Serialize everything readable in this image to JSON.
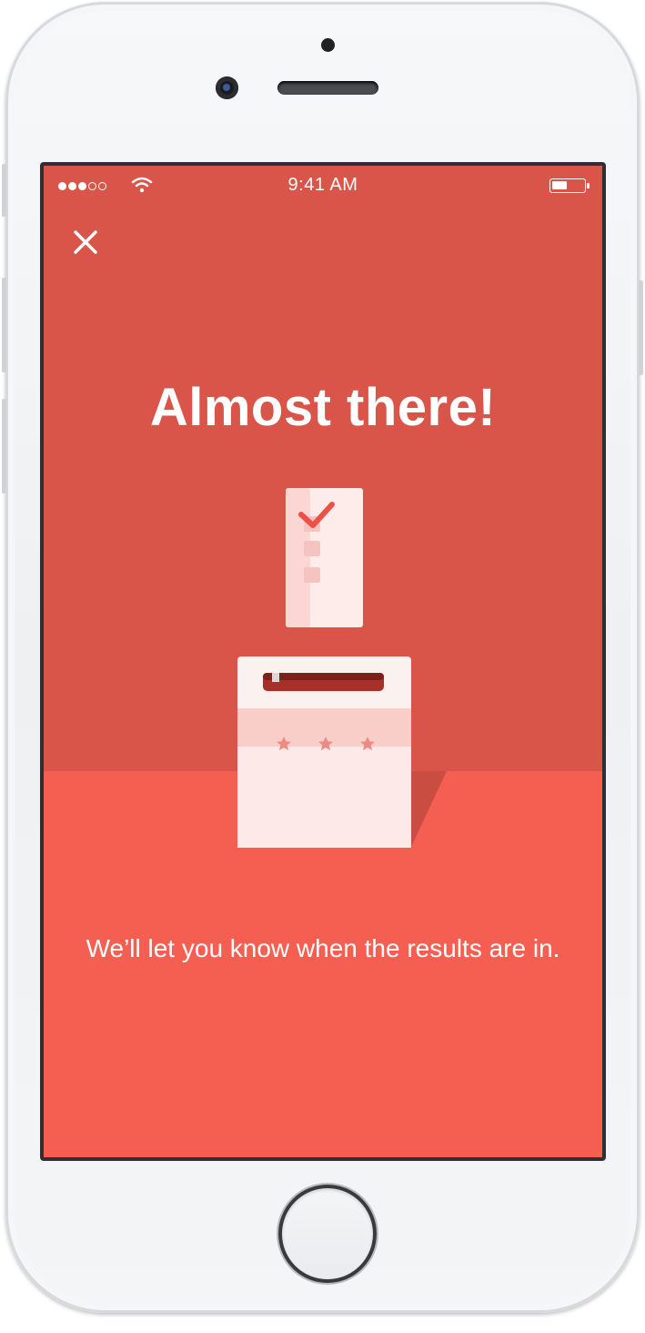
{
  "status_bar": {
    "time": "9:41 AM",
    "signal_bars_filled": 3,
    "signal_bars_total": 5,
    "battery_level": 0.45
  },
  "icons": {
    "close": "close-icon",
    "illustration": "ballot-box-illustration"
  },
  "main": {
    "title": "Almost there!",
    "message": "We’ll let you know when the results are in."
  },
  "colors": {
    "background_top": "#d95549",
    "background_floor": "#f55f52",
    "text": "#ffffff",
    "check_mark": "#ec5148"
  }
}
